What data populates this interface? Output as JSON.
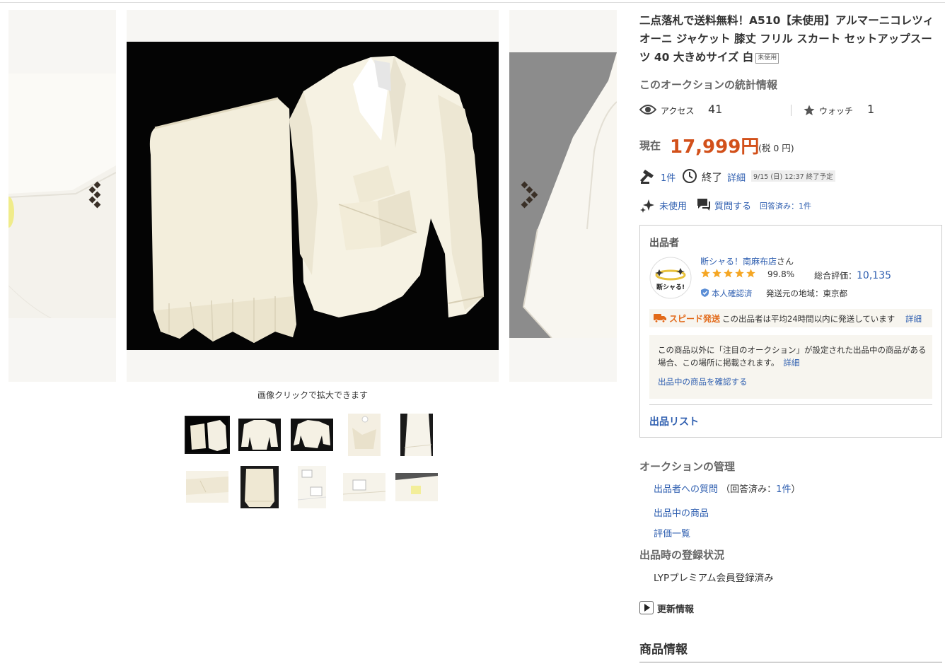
{
  "item": {
    "title": "二点落札で送料無料！A510【未使用】アルマーニコレツィオーニ ジャケット 膝丈 フリル スカート セットアップスーツ 40 大きめサイズ 白",
    "condition_badge": "未使用"
  },
  "gallery": {
    "zoom_hint": "画像クリックで拡大できます",
    "thumbnails": [
      {
        "name": "thumb-1",
        "active": true
      },
      {
        "name": "thumb-2"
      },
      {
        "name": "thumb-3"
      },
      {
        "name": "thumb-4"
      },
      {
        "name": "thumb-5"
      },
      {
        "name": "thumb-6"
      },
      {
        "name": "thumb-7"
      },
      {
        "name": "thumb-8"
      },
      {
        "name": "thumb-9"
      },
      {
        "name": "thumb-10"
      }
    ]
  },
  "stats": {
    "heading": "このオークションの統計情報",
    "access_label": "アクセス",
    "access_count": "41",
    "watch_label": "ウォッチ",
    "watch_count": "1"
  },
  "price": {
    "label": "現在",
    "value": "17,999円",
    "tax": "(税 0 円)"
  },
  "status": {
    "bids": "1件",
    "end_label": "終了",
    "detail_link": "詳細",
    "end_time": "9/15 (日) 12:37 終了予定",
    "condition": "未使用",
    "question_link": "質問する",
    "answered": "回答済み：1件"
  },
  "seller": {
    "heading": "出品者",
    "avatar_text": "断シャる!",
    "name": "断シャる！南麻布店",
    "name_suffix": "さん",
    "rating_stars": 5,
    "rating_pct": "99.8%",
    "total_eval_label": "総合評価：",
    "total_eval_value": "10,135",
    "verified": "本人確認済",
    "ship_from": "発送元の地域：東京都",
    "speed_label": "スピード発送",
    "speed_text": "この出品者は平均24時間以内に発送しています",
    "speed_detail": "詳細",
    "notice_text": "この商品以外に「注目のオークション」が設定された出品中の商品がある場合、この場所に掲載されます。",
    "notice_detail": "詳細",
    "notice_link": "出品中の商品を確認する",
    "list_link": "出品リスト"
  },
  "manage": {
    "heading": "オークションの管理",
    "q_to_seller": "出品者への質問",
    "q_answered_prefix": "（回答済み：",
    "q_answered_count": "1件",
    "q_answered_suffix": "）",
    "listing_items": "出品中の商品",
    "eval_list": "評価一覧"
  },
  "registration": {
    "heading": "出品時の登録状況",
    "value": "LYPプレミアム会員登録済み"
  },
  "update": {
    "label": "更新情報"
  },
  "product_info": {
    "heading": "商品情報"
  },
  "colors": {
    "price": "#d2501a",
    "link": "#2f5fb0",
    "star": "#f5a623",
    "speed": "#e26a1a"
  },
  "icons": [
    "eye-icon",
    "star-icon",
    "gavel-icon",
    "clock-icon",
    "sparkle-icon",
    "chat-icon",
    "verified-icon",
    "truck-icon",
    "play-icon",
    "chevron-left-icon",
    "chevron-right-icon"
  ]
}
